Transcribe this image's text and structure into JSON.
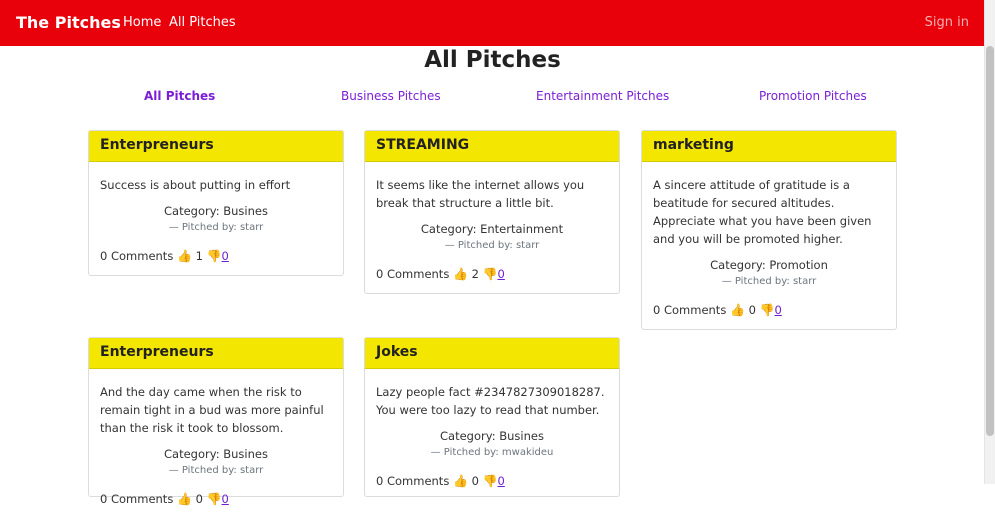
{
  "navbar": {
    "brand": "The Pitches",
    "home": "Home",
    "all_pitches": "All Pitches",
    "sign_in": "Sign in"
  },
  "page_title": "All Pitches",
  "category_nav": {
    "all": "All Pitches",
    "business": "Business Pitches",
    "entertainment": "Entertainment Pitches",
    "promotion": "Promotion Pitches"
  },
  "cards": [
    {
      "title": "Enterpreneurs",
      "text": "Success is about putting in effort",
      "category": "Category: Busines",
      "pitched_by": "— Pitched by: starr",
      "comments": "0 Comments",
      "upvotes": "1",
      "downvotes": "0"
    },
    {
      "title": "STREAMING",
      "text": "It seems like the internet allows you break that structure a little bit.",
      "category": "Category: Entertainment",
      "pitched_by": "— Pitched by: starr",
      "comments": "0 Comments",
      "upvotes": "2",
      "downvotes": "0"
    },
    {
      "title": "marketing",
      "text": "A sincere attitude of gratitude is a beatitude for secured altitudes. Appreciate what you have been given and you will be promoted higher.",
      "category": "Category: Promotion",
      "pitched_by": "— Pitched by: starr",
      "comments": "0 Comments",
      "upvotes": "0",
      "downvotes": "0"
    },
    {
      "title": "Enterpreneurs",
      "text": "And the day came when the risk to remain tight in a bud was more painful than the risk it took to blossom.",
      "category": "Category: Busines",
      "pitched_by": "— Pitched by: starr",
      "comments": "0 Comments",
      "upvotes": "0",
      "downvotes": "0"
    },
    {
      "title": "Jokes",
      "text": "Lazy people fact #2347827309018287. You were too lazy to read that number.",
      "category": "Category: Busines",
      "pitched_by": "— Pitched by: mwakideu",
      "comments": "0 Comments",
      "upvotes": "0",
      "downvotes": "0"
    }
  ],
  "icons": {
    "upvote": "thumbs-up-icon",
    "downvote": "thumbs-down-icon"
  },
  "colors": {
    "navbar": "#e8000b",
    "card_header": "#f3e600",
    "link": "#7b1fd6"
  }
}
